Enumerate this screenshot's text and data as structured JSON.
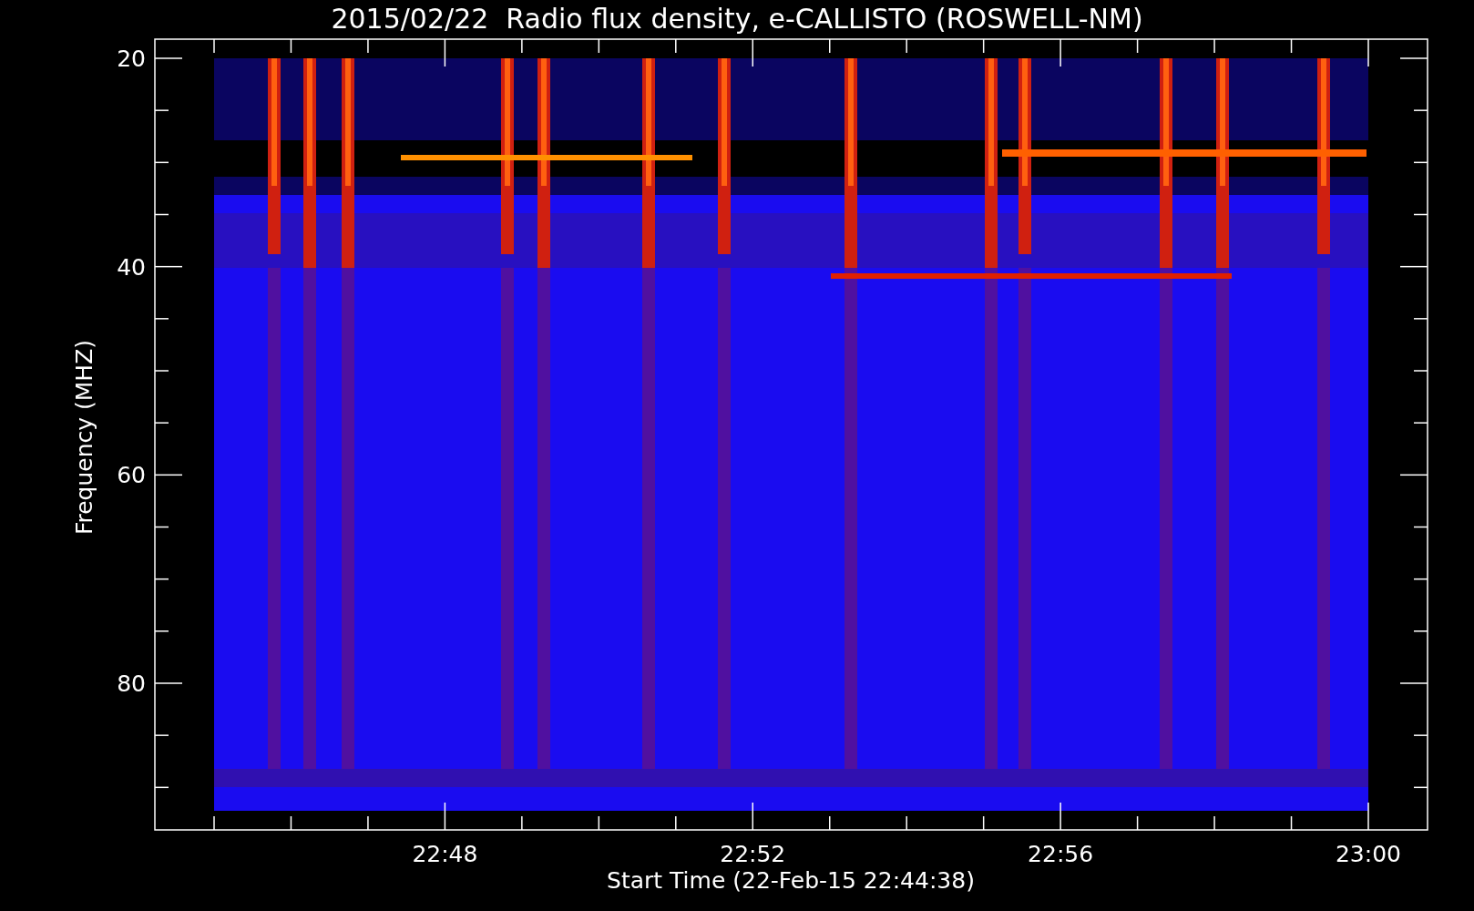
{
  "title": "2015/02/22  Radio flux density, e-CALLISTO (ROSWELL-NM)",
  "y_axis": {
    "label": "Frequency (MHZ)",
    "tick_labels": [
      "20",
      "40",
      "60",
      "80"
    ]
  },
  "x_axis": {
    "label": "Start Time (22-Feb-15 22:44:38)",
    "tick_labels": [
      "22:48",
      "22:52",
      "22:56",
      "23:00"
    ]
  }
}
